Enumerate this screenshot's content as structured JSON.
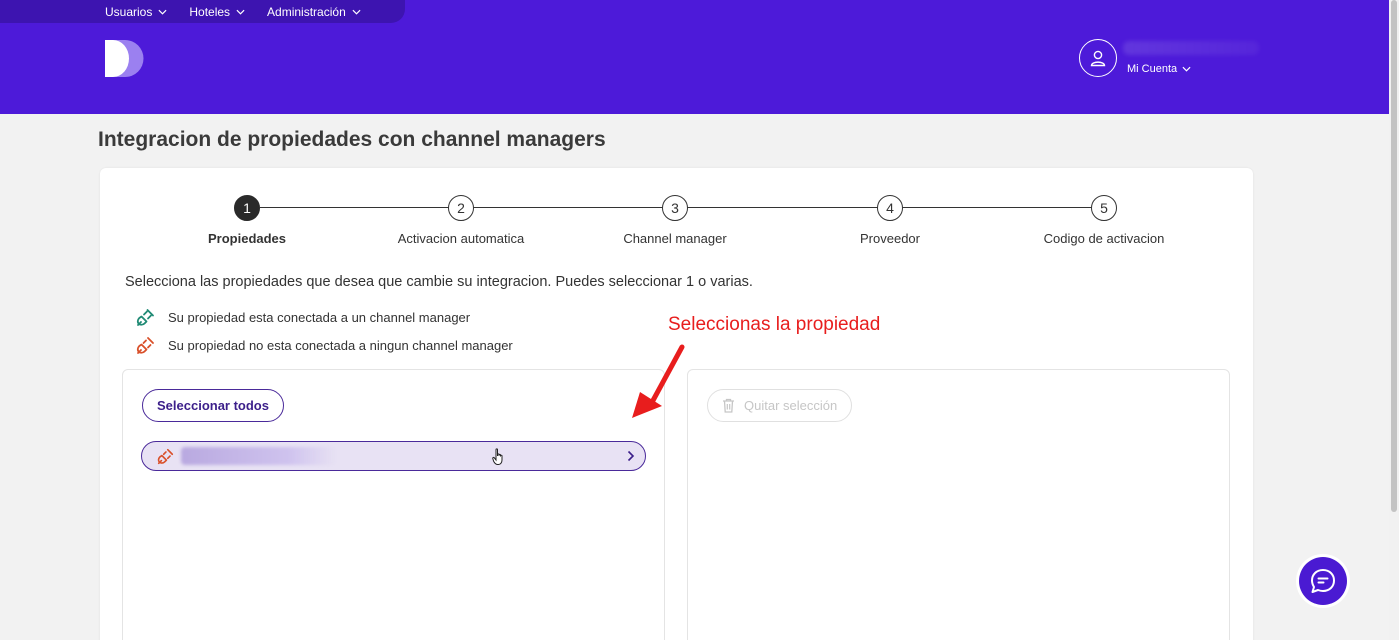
{
  "nav": {
    "items": [
      {
        "label": "Usuarios"
      },
      {
        "label": "Hoteles"
      },
      {
        "label": "Administración"
      }
    ]
  },
  "account": {
    "label": "Mi Cuenta"
  },
  "page": {
    "title": "Integracion de propiedades con channel managers"
  },
  "stepper": {
    "steps": [
      {
        "number": "1",
        "label": "Propiedades",
        "active": true
      },
      {
        "number": "2",
        "label": "Activacion automatica",
        "active": false
      },
      {
        "number": "3",
        "label": "Channel manager",
        "active": false
      },
      {
        "number": "4",
        "label": "Proveedor",
        "active": false
      },
      {
        "number": "5",
        "label": "Codigo de activacion",
        "active": false
      }
    ]
  },
  "instructions": "Selecciona las propiedades que desea que cambie su integracion. Puedes seleccionar 1 o varias.",
  "legend": {
    "connected": {
      "label": "Su propiedad esta conectada a un channel manager",
      "icon": "plug-connected-icon",
      "color": "#1f8a74"
    },
    "disconnected": {
      "label": "Su propiedad no esta conectada a ningun channel manager",
      "icon": "plug-disconnected-icon",
      "color": "#d9502a"
    }
  },
  "left_panel": {
    "select_all_label": "Seleccionar todos"
  },
  "right_panel": {
    "clear_selection_label": "Quitar selección"
  },
  "annotation": {
    "text": "Seleccionas la propiedad",
    "color": "#e81d1d"
  },
  "colors": {
    "brand": "#4d1ad9",
    "accent": "#4a2a9a"
  }
}
